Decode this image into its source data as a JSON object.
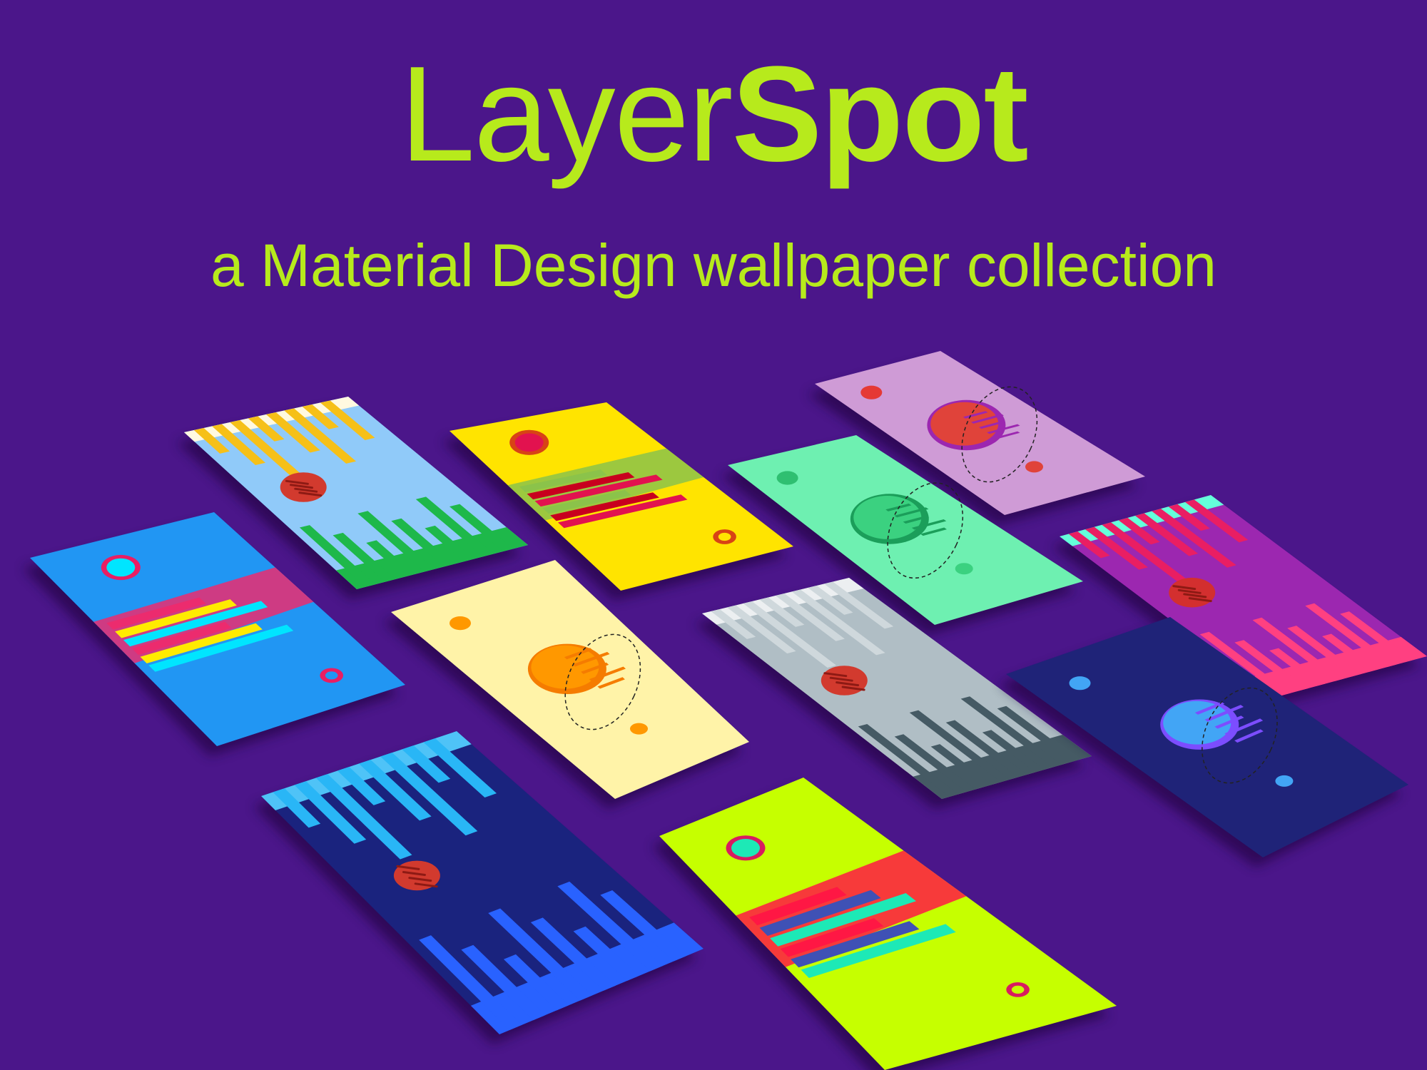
{
  "header": {
    "title_light": "Layer",
    "title_bold": "Spot",
    "subtitle": "a Material Design wallpaper collection"
  },
  "colors": {
    "background": "#4b168a",
    "accent": "#b7ea1c"
  },
  "wallpapers": [
    {
      "id": "w1",
      "style": "drips",
      "bg": "#90caf9",
      "c1": "#f6c018",
      "c2": "#1eb84a",
      "ball": "#d23a2e",
      "top": "#fff9e0"
    },
    {
      "id": "w2",
      "style": "comet",
      "bg": "#ffe400",
      "c1": "#e2124f",
      "c2": "#8bc34a",
      "c3": "#c8001e",
      "ring": "#d84315"
    },
    {
      "id": "w3",
      "style": "planet",
      "bg": "#cf9bd6",
      "c1": "#e0433a",
      "c2": "#9c27b0",
      "sun": "#e53935"
    },
    {
      "id": "w4",
      "style": "comet",
      "bg": "#2196f3",
      "c1": "#00e5ff",
      "c2": "#ec2b6e",
      "c3": "#ffeb00",
      "ring": "#e91e63"
    },
    {
      "id": "w5",
      "style": "planet",
      "bg": "#6ef0b1",
      "c1": "#3bd180",
      "c2": "#1b9e5a",
      "sun": "#2fbf71"
    },
    {
      "id": "w6",
      "style": "drips",
      "bg": "#9c27b0",
      "c1": "#e91e63",
      "c2": "#ff4081",
      "ball": "#d32f2f",
      "top": "#64ffda"
    },
    {
      "id": "w7",
      "style": "planet",
      "bg": "#fff3a8",
      "c1": "#ff9800",
      "c2": "#f57c00",
      "sun": "#ff9800"
    },
    {
      "id": "w8",
      "style": "drips",
      "bg": "#b0bec5",
      "c1": "#cfd8dc",
      "c2": "#455a64",
      "ball": "#d23a2e",
      "top": "#eceff1"
    },
    {
      "id": "w9",
      "style": "planet",
      "bg": "#1f2378",
      "c1": "#42a5f5",
      "c2": "#7c4dff",
      "sun": "#42a5f5"
    },
    {
      "id": "w10",
      "style": "drips",
      "bg": "#1a237e",
      "c1": "#29b6f6",
      "c2": "#2962ff",
      "ball": "#d23a2e",
      "top": "#4fc3f7"
    },
    {
      "id": "w11",
      "style": "comet",
      "bg": "#c6ff00",
      "c1": "#1de9b6",
      "c2": "#ff1744",
      "c3": "#3f51b5",
      "ring": "#d81b60"
    }
  ]
}
